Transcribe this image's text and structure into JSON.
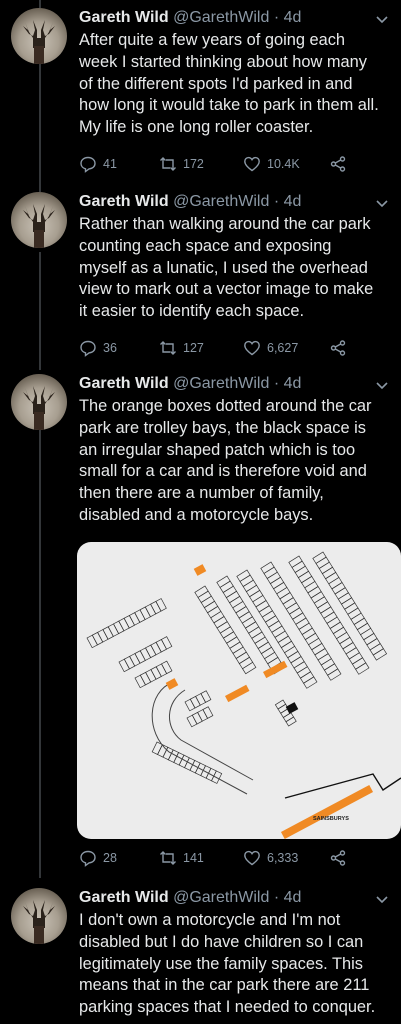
{
  "tweets": [
    {
      "author": "Gareth Wild",
      "handle": "@GarethWild",
      "time": "4d",
      "text": "After quite a few years of going each\nweek I started thinking about how many\nof the different spots I'd parked in and\nhow long it would take to park in them all.\nMy life is one long roller coaster.",
      "replies": "41",
      "retweets": "172",
      "likes": "10.4K"
    },
    {
      "author": "Gareth Wild",
      "handle": "@GarethWild",
      "time": "4d",
      "text": "Rather than walking around the car park\ncounting each space and exposing\nmyself as a lunatic, I used the overhead\nview to mark out a vector image to make\nit easier to identify each space.",
      "replies": "36",
      "retweets": "127",
      "likes": "6,627"
    },
    {
      "author": "Gareth Wild",
      "handle": "@GarethWild",
      "time": "4d",
      "text": "The orange boxes dotted around the car\npark are trolley bays, the black space is\nan irregular shaped patch which is too\nsmall for a car and is therefore void and\nthen there are a number of family,\ndisabled and a motorcycle bays.",
      "replies": "28",
      "retweets": "141",
      "likes": "6,333",
      "media_label": "SAINSBURYS"
    },
    {
      "author": "Gareth Wild",
      "handle": "@GarethWild",
      "time": "4d",
      "text": "I don't own a motorcycle and I'm not\ndisabled but I do have children so I can\nlegitimately use the family spaces. This\nmeans that in the car park there are 211\nparking spaces that I needed to conquer."
    }
  ],
  "separator": "·",
  "colors": {
    "background": "#000000",
    "text": "#e7e9ea",
    "muted": "#8b98a5",
    "thread_line": "#333639",
    "map_bg": "#ececec",
    "trolley_bay": "#f08a24"
  },
  "icons": [
    "reply-icon",
    "retweet-icon",
    "like-icon",
    "share-icon",
    "chevron-down-icon"
  ]
}
